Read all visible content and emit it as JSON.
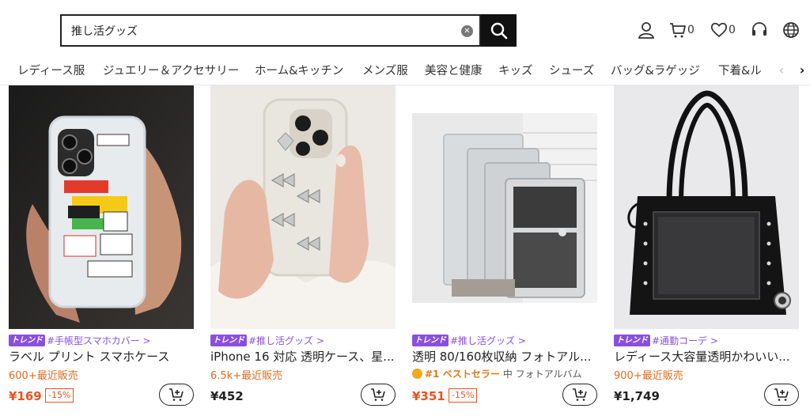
{
  "search": {
    "value": "推し活グッズ"
  },
  "header": {
    "cart_count": "0",
    "wishlist_count": "0"
  },
  "categories": [
    "レディース服",
    "ジュエリー＆アクセサリー",
    "ホーム&キッチン",
    "メンズ服",
    "美容と健康",
    "キッズ",
    "シューズ",
    "バッグ&ラゲッジ",
    "下着&ル"
  ],
  "products": [
    {
      "badge": "トレンド",
      "tag": "#手帳型スマホカバー >",
      "title": "ラベル プリント スマホケース",
      "sales": "600+最近販売",
      "price": "¥169",
      "discount": "-15%"
    },
    {
      "badge": "トレンド",
      "tag": "#推し活グッズ >",
      "title": "iPhone 16 対応 透明ケース、星...",
      "sales": "6.5k+最近販売",
      "price": "¥452"
    },
    {
      "badge": "トレンド",
      "tag": "#推し活グッズ >",
      "title": "透明 80/160枚収納 フォトアル...",
      "best_label": "#1 ベストセラー",
      "best_category": "中 フォトアルバム",
      "price": "¥351",
      "discount": "-15%"
    },
    {
      "badge": "トレンド",
      "tag": "#通勤コーデ >",
      "title": "レディース大容量透明かわいい...",
      "sales": "900+最近販売",
      "price": "¥1,749"
    }
  ]
}
